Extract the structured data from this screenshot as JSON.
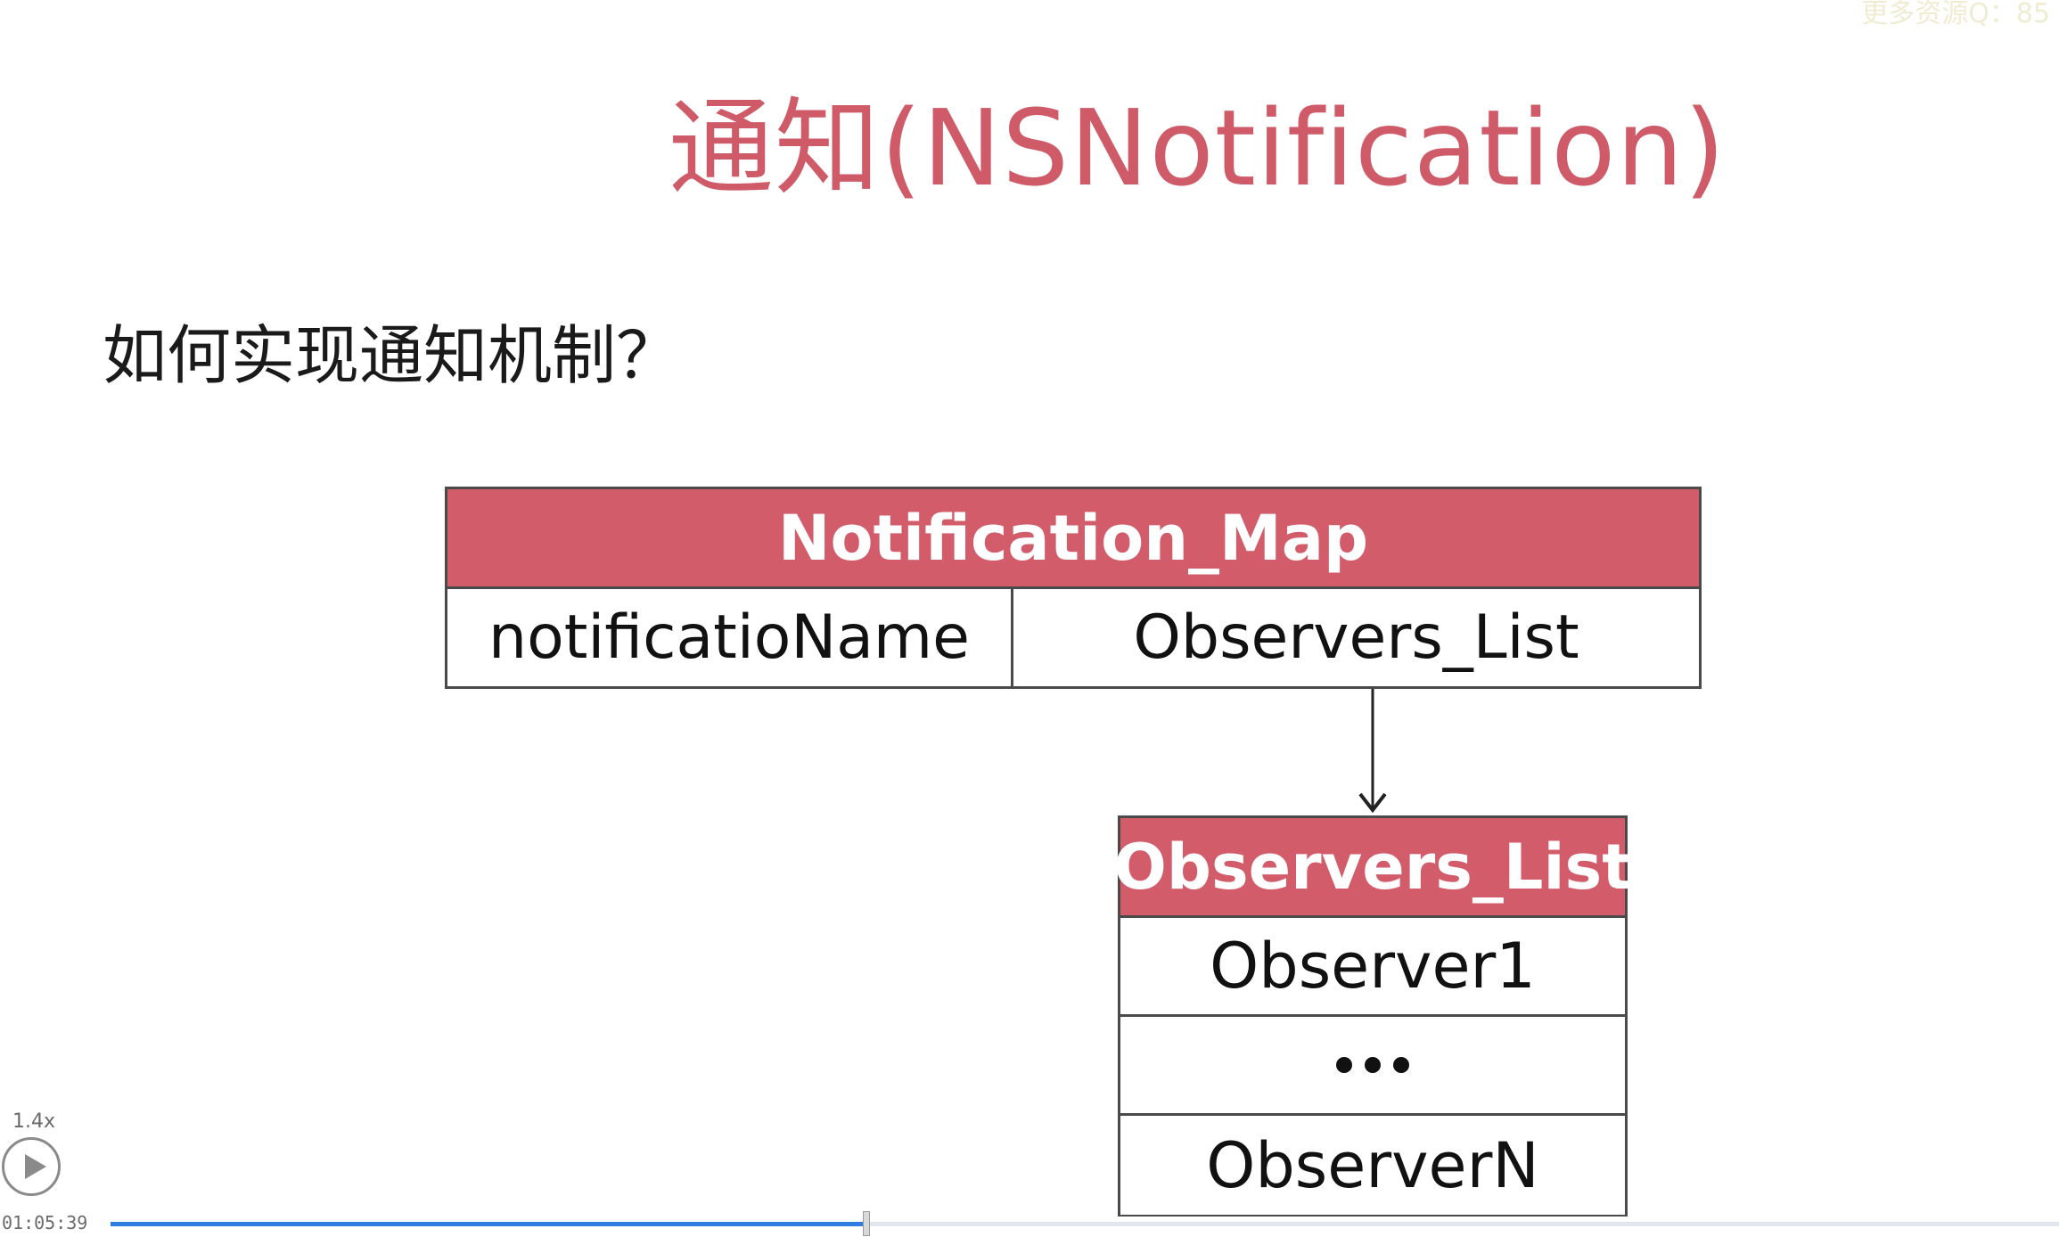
{
  "slide": {
    "watermark": "更多资源Q：85",
    "title": "通知(NSNotification)",
    "question": "如何实现通知机制？",
    "colors": {
      "title": "#cf5a68",
      "header_bg": "#d35c6b",
      "header_text": "#ffffff"
    }
  },
  "notification_map": {
    "header": "Notification_Map",
    "key_cell": "notificatioName",
    "value_cell": "Observers_List"
  },
  "observers_list": {
    "header": "Observers_List",
    "first": "Observer1",
    "ellipsis_icon": "ellipsis-dots",
    "last": "ObserverN"
  },
  "player": {
    "speed": "1.4x",
    "play_icon": "play-icon",
    "time": "01:05:39",
    "progress_fraction": 0.388,
    "progress_color": "#2f7de0"
  }
}
